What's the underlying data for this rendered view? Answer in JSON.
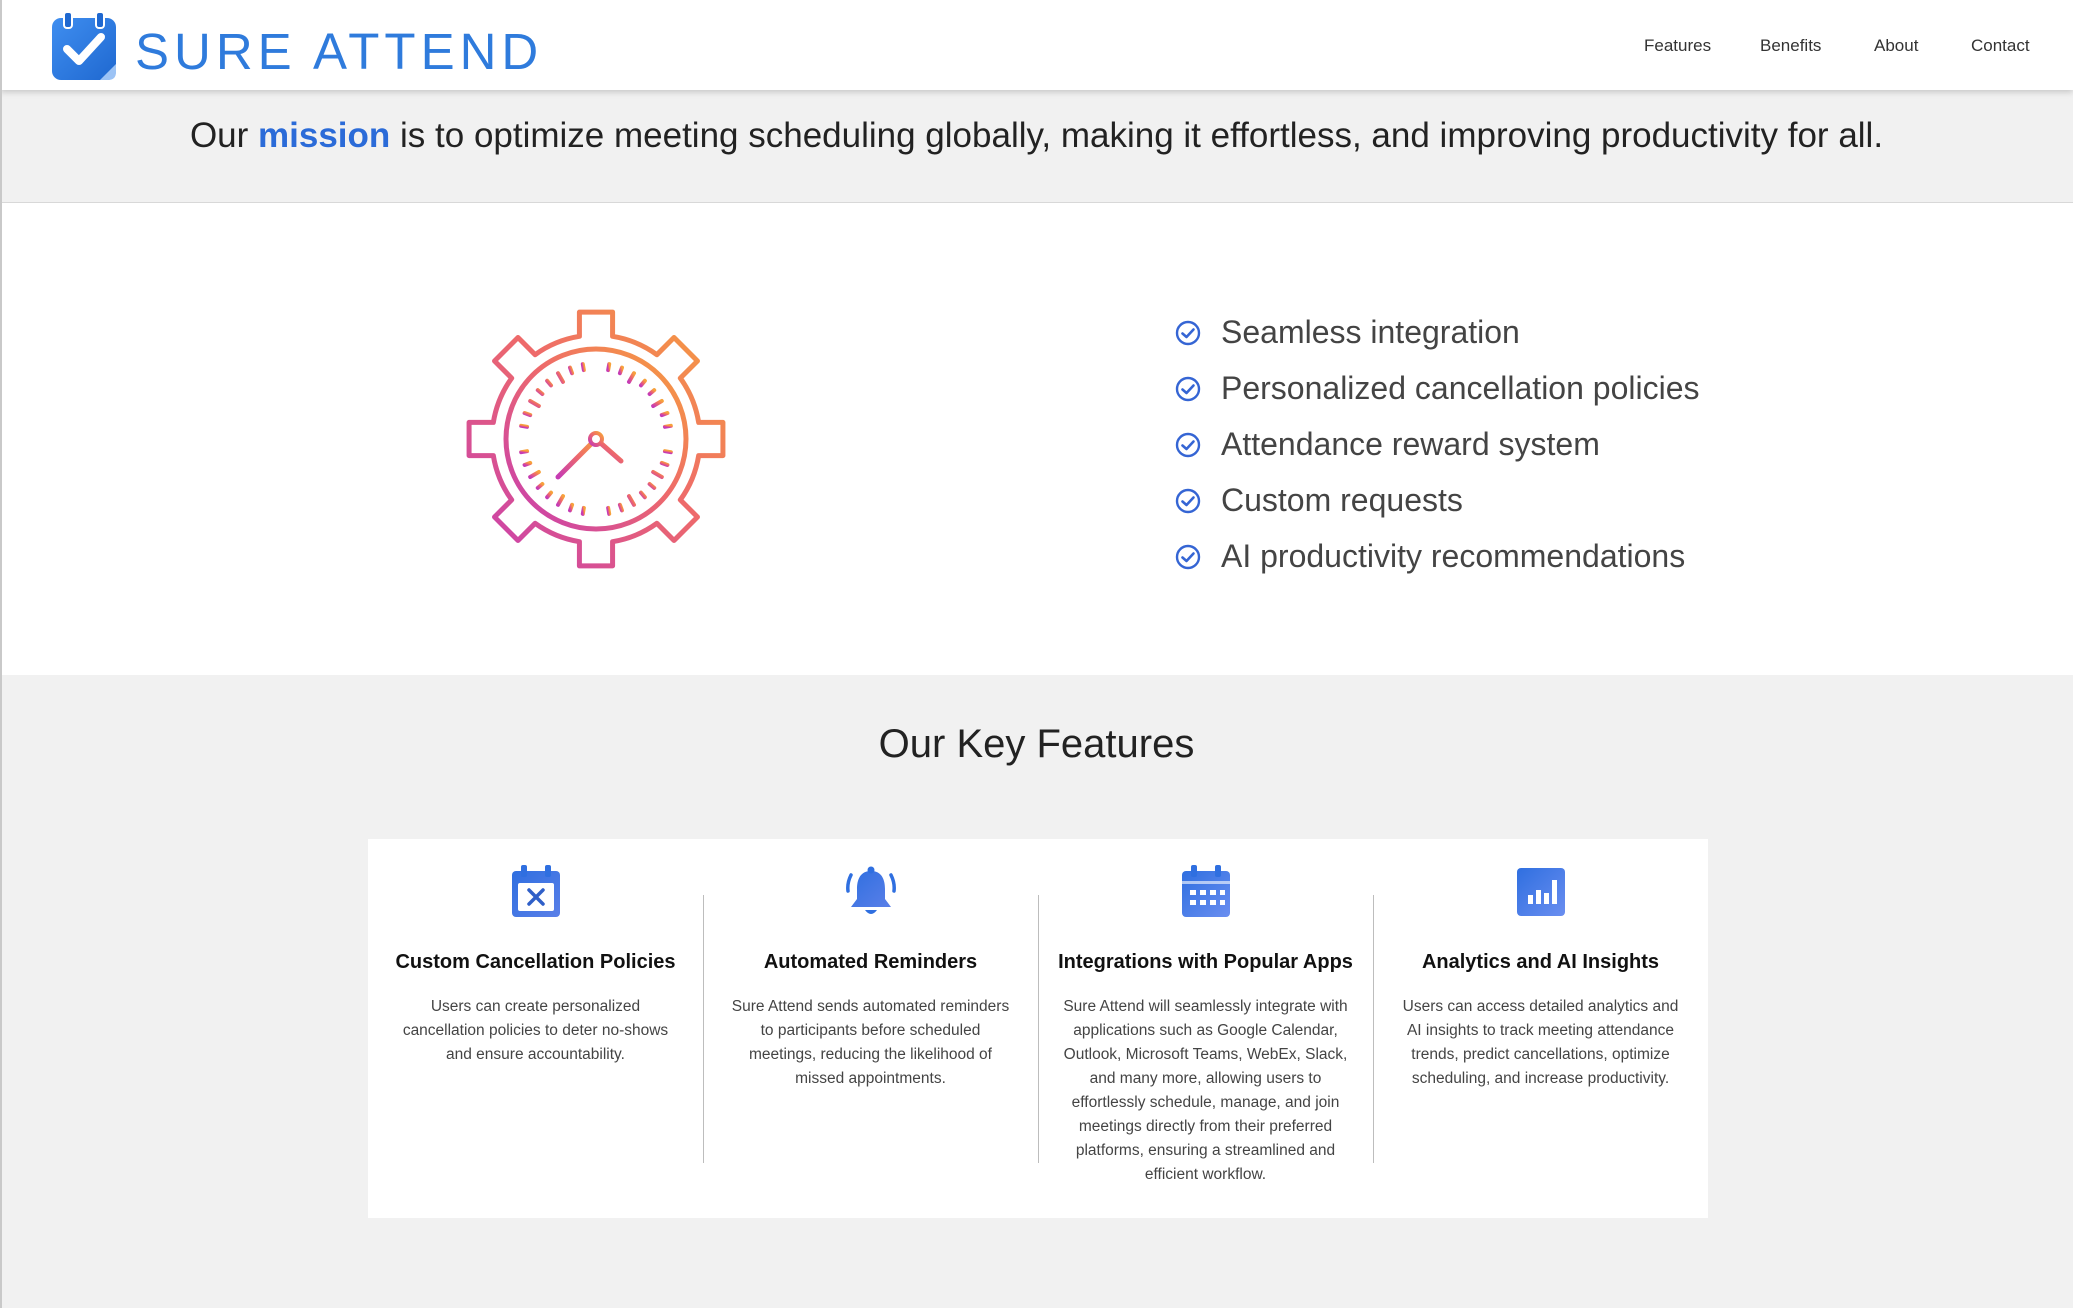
{
  "header": {
    "brand": "SURE ATTEND",
    "logo_icon": "calendar-check-icon",
    "nav": [
      {
        "label": "Features"
      },
      {
        "label": "Benefits"
      },
      {
        "label": "About"
      },
      {
        "label": "Contact"
      }
    ]
  },
  "mission": {
    "prefix": "Our",
    "highlight": "mission",
    "suffix": "is to optimize meeting scheduling globally, making it effortless, and improving productivity for all."
  },
  "hero": {
    "illustration": "gear-clock-icon",
    "checklist": [
      "Seamless integration",
      "Personalized cancellation policies",
      "Attendance reward system",
      "Custom requests",
      "AI productivity recommendations"
    ]
  },
  "features": {
    "title": "Our Key Features",
    "items": [
      {
        "icon": "calendar-x-icon",
        "title": "Custom Cancellation Policies",
        "text": "Users can create personalized cancellation policies to deter no-shows and ensure accountability."
      },
      {
        "icon": "bell-icon",
        "title": "Automated Reminders",
        "text": "Sure Attend sends automated reminders to participants before scheduled meetings, reducing the likelihood of missed appointments."
      },
      {
        "icon": "calendar-grid-icon",
        "title": "Integrations with Popular Apps",
        "text": "Sure Attend will seamlessly integrate with applications such as Google Calendar, Outlook, Microsoft Teams, WebEx, Slack, and many more, allowing users to effortlessly schedule, manage, and join meetings directly from their preferred platforms, ensuring a streamlined and efficient workflow."
      },
      {
        "icon": "bar-chart-icon",
        "title": "Analytics and AI Insights",
        "text": "Users can access detailed analytics and AI insights to track meeting attendance trends, predict cancellations, optimize scheduling, and increase productivity."
      }
    ]
  },
  "colors": {
    "brand": "#2f7bdc",
    "accent": "#2b6bd8",
    "gradient_start": "#c53bb5",
    "gradient_end": "#f7a23b"
  }
}
